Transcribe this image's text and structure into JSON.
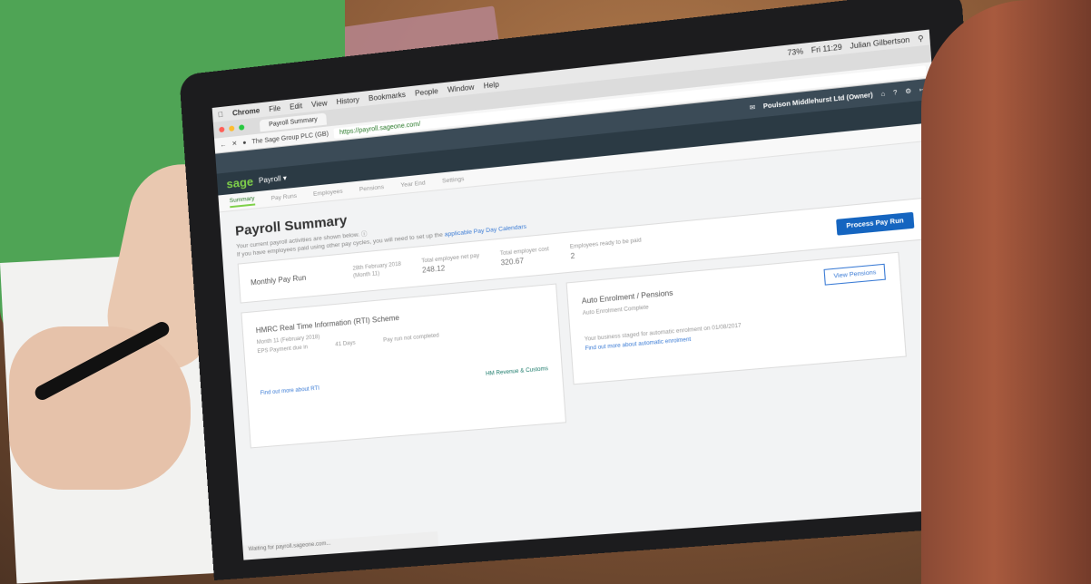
{
  "mac_menu": {
    "app": "Chrome",
    "items": [
      "File",
      "Edit",
      "View",
      "History",
      "Bookmarks",
      "People",
      "Window",
      "Help"
    ],
    "battery": "73%",
    "clock": "Fri 11:29",
    "user": "Julian Gilbertson"
  },
  "browser": {
    "tab_title": "Payroll Summary",
    "site_identity": "The Sage Group PLC (GB)",
    "url": "https://payroll.sageone.com/",
    "status": "Waiting for payroll.sageone.com..."
  },
  "sage": {
    "company": "Poulson Middlehurst Ltd (Owner)",
    "logo": "sage",
    "product": "Payroll ▾",
    "nav": [
      "Summary",
      "Pay Runs",
      "Employees",
      "Pensions",
      "Year End",
      "Settings"
    ]
  },
  "page": {
    "title": "Payroll Summary",
    "intro": "Your current payroll activities are shown below.",
    "intro2": "If you have employees paid using other pay cycles, you will need to set up the",
    "intro2_link": "applicable Pay Day Calendars"
  },
  "pay_run": {
    "label": "Monthly Pay Run",
    "date": "28th February 2018",
    "period": "(Month 11)",
    "net_pay_label": "Total employee net pay",
    "net_pay": "248.12",
    "cost_label": "Total employer cost",
    "cost": "320.67",
    "ready_label": "Employees ready to be paid",
    "ready": "2",
    "button": "Process Pay Run"
  },
  "rti": {
    "title": "HMRC Real Time Information (RTI) Scheme",
    "month": "Month 11 (February 2018)",
    "eps": "EPS Payment due in",
    "days": "41 Days",
    "status": "Pay run not completed",
    "link": "Find out more about RTI",
    "badge": "HM Revenue & Customs"
  },
  "pensions": {
    "title": "Auto Enrolment / Pensions",
    "status": "Auto Enrolment Complete",
    "button": "View Pensions",
    "note": "Your business staged for automatic enrolment on 01/08/2017",
    "link": "Find out more about automatic enrolment"
  }
}
